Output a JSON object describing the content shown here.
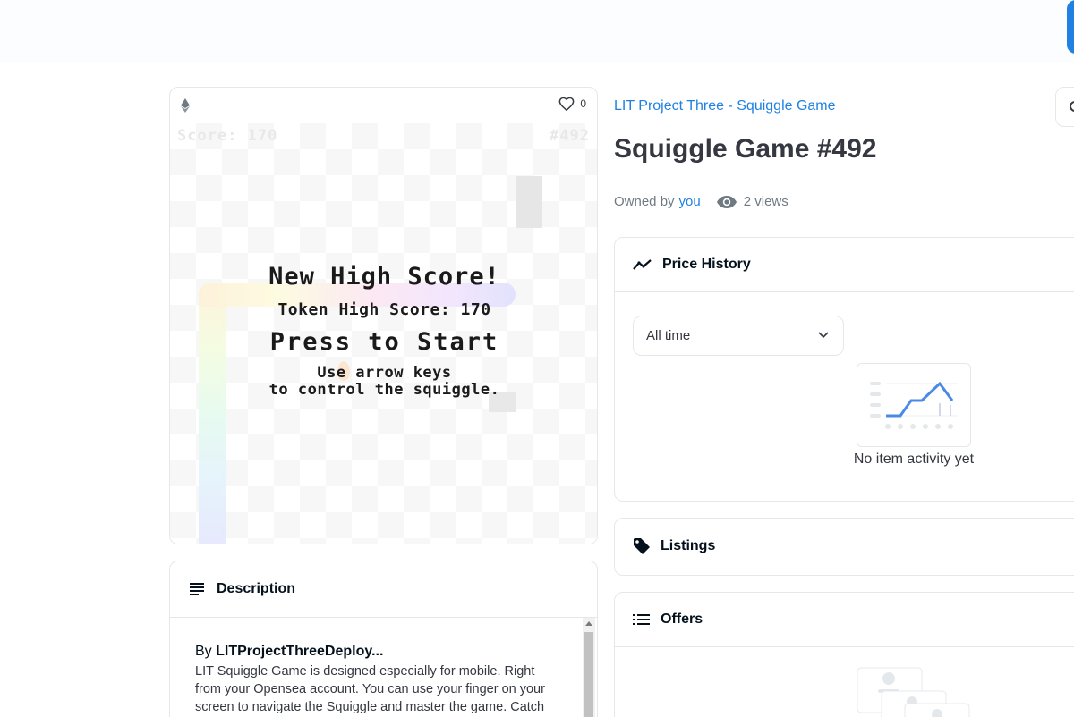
{
  "header": {
    "action_button": ""
  },
  "media": {
    "like_count": "0",
    "game": {
      "score_label": "Score: 170",
      "token_id": "#492",
      "headline": "New High Score!",
      "token_high_score": "Token High Score: 170",
      "cta": "Press to Start",
      "instructions_line1": "Use arrow keys",
      "instructions_line2": "to control the squiggle."
    }
  },
  "description": {
    "title": "Description",
    "by_prefix": "By",
    "creator": "LITProjectThreeDeploy...",
    "text": "LIT Squiggle Game is designed especially for mobile. Right from your Opensea account. You can use your finger on your screen to navigate the Squiggle and master the game. Catch"
  },
  "item": {
    "collection": "LIT Project Three - Squiggle Game",
    "title": "Squiggle Game #492",
    "owned_by_label": "Owned by",
    "owner": "you",
    "views": "2 views"
  },
  "price_history": {
    "title": "Price History",
    "range_selected": "All time",
    "empty_text": "No item activity yet"
  },
  "listings": {
    "title": "Listings"
  },
  "offers": {
    "title": "Offers"
  },
  "colors": {
    "accent": "#2081e2",
    "text": "#353840",
    "muted": "#707a83",
    "border": "#e5e8eb"
  }
}
